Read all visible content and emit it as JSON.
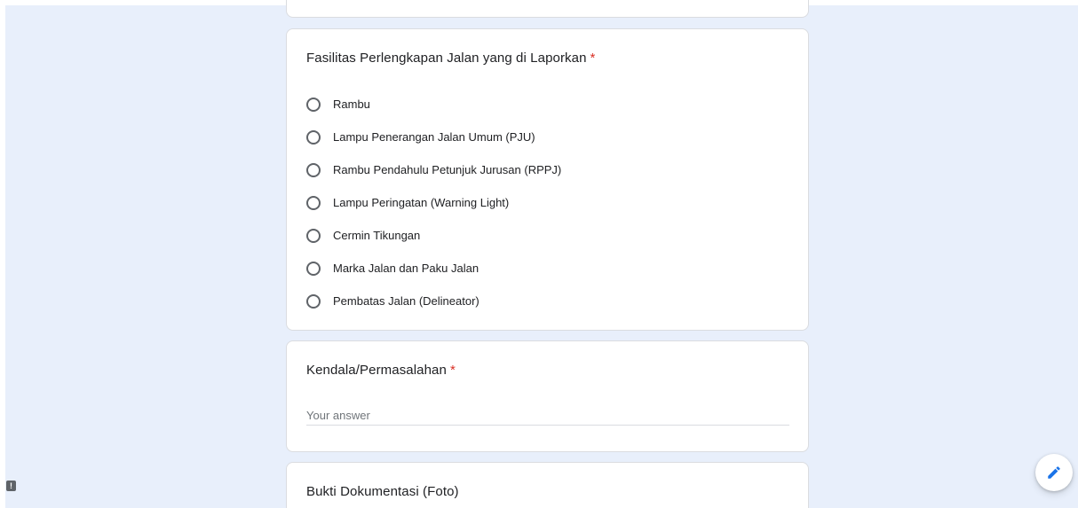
{
  "form": {
    "facilities_question": {
      "title": "Fasilitas Perlengkapan Jalan yang di Laporkan",
      "required_mark": "*",
      "options": [
        {
          "label": "Rambu"
        },
        {
          "label": "Lampu Penerangan Jalan Umum (PJU)"
        },
        {
          "label": "Rambu Pendahulu Petunjuk Jurusan (RPPJ)"
        },
        {
          "label": "Lampu Peringatan (Warning Light)"
        },
        {
          "label": "Cermin Tikungan"
        },
        {
          "label": "Marka Jalan dan Paku Jalan"
        },
        {
          "label": "Pembatas Jalan (Delineator)"
        }
      ]
    },
    "kendala_question": {
      "title": "Kendala/Permasalahan",
      "required_mark": "*",
      "value": "",
      "placeholder": "Your answer"
    },
    "bukti_question": {
      "title": "Bukti Dokumentasi (Foto)"
    }
  },
  "floating": {
    "edit_icon": "pencil-icon",
    "report_icon": "exclamation-icon",
    "report_glyph": "!"
  },
  "colors": {
    "background": "#e8effb",
    "card": "#ffffff",
    "required": "#d93025",
    "accent": "#1a73e8"
  }
}
